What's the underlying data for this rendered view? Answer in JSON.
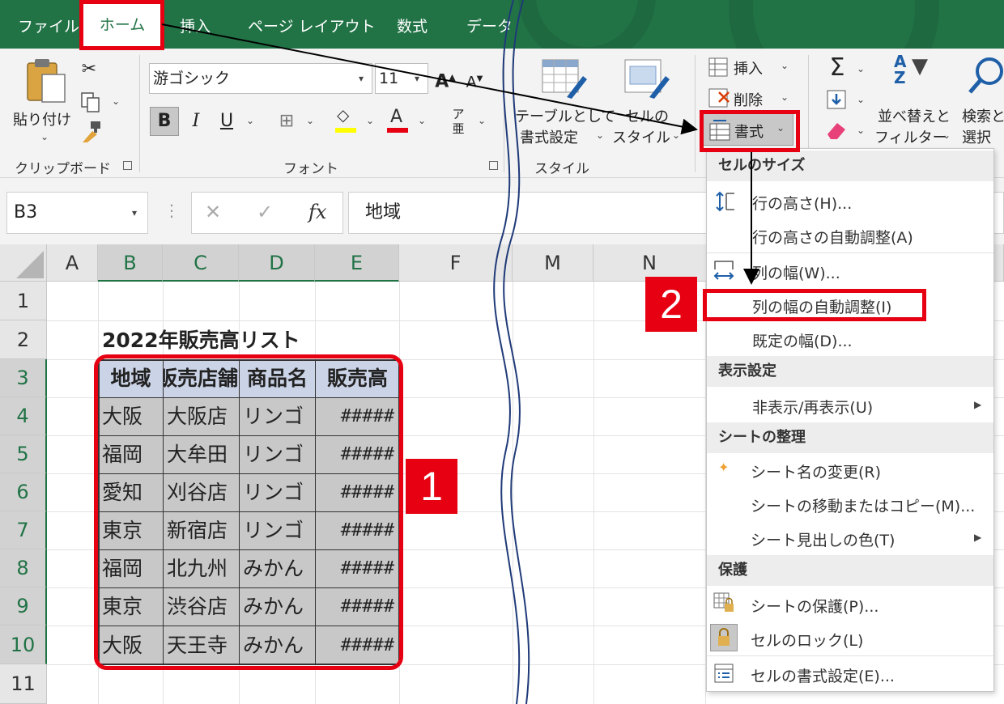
{
  "tabs": [
    "ファイル",
    "ホーム",
    "挿入",
    "ページ レイアウト",
    "数式",
    "データ"
  ],
  "active_tab": "ホーム",
  "ribbon": {
    "clipboard": {
      "paste_label": "貼り付け",
      "group_label": "クリップボード"
    },
    "font": {
      "font_name": "游ゴシック",
      "font_size": "11",
      "bold": "B",
      "italic": "I",
      "underline": "U",
      "group_label": "フォント"
    },
    "styles": {
      "table_format_line1": "テーブルとして",
      "table_format_line2": "書式設定",
      "cell_styles_line1": "セルの",
      "cell_styles_line2": "スタイル",
      "group_label": "スタイル"
    },
    "cells": {
      "insert_label": "挿入",
      "delete_label": "削除",
      "format_label": "書式"
    },
    "editing": {
      "sort_line1": "並べ替えと",
      "sort_line2": "フィルター",
      "find_line1": "検索と",
      "find_line2": "選択"
    }
  },
  "formula_bar": {
    "name_box": "B3",
    "fx_label": "fx",
    "value": "地域"
  },
  "grid": {
    "columns": [
      "A",
      "B",
      "C",
      "D",
      "E",
      "F",
      "M",
      "N"
    ],
    "rows": [
      "1",
      "2",
      "3",
      "4",
      "5",
      "6",
      "7",
      "8",
      "9",
      "10",
      "11"
    ],
    "title": "2022年販売高リスト",
    "table_headers": [
      "地域",
      "販売店舗",
      "商品名",
      "販売高"
    ],
    "table_rows": [
      [
        "大阪",
        "大阪店",
        "リンゴ",
        "#####"
      ],
      [
        "福岡",
        "大牟田",
        "リンゴ",
        "#####"
      ],
      [
        "愛知",
        "刈谷店",
        "リンゴ",
        "#####"
      ],
      [
        "東京",
        "新宿店",
        "リンゴ",
        "#####"
      ],
      [
        "福岡",
        "北九州",
        "みかん",
        "#####"
      ],
      [
        "東京",
        "渋谷店",
        "みかん",
        "#####"
      ],
      [
        "大阪",
        "天王寺",
        "みかん",
        "#####"
      ]
    ]
  },
  "format_menu": {
    "section_cell_size": "セルのサイズ",
    "row_height": "行の高さ(H)...",
    "row_autofit": "行の高さの自動調整(A)",
    "col_width": "列の幅(W)...",
    "col_autofit": "列の幅の自動調整(I)",
    "default_width": "既定の幅(D)...",
    "section_visibility": "表示設定",
    "hide_unhide": "非表示/再表示(U)",
    "section_organize": "シートの整理",
    "rename_sheet": "シート名の変更(R)",
    "move_copy": "シートの移動またはコピー(M)...",
    "tab_color": "シート見出しの色(T)",
    "section_protection": "保護",
    "protect_sheet": "シートの保護(P)...",
    "lock_cell": "セルのロック(L)",
    "format_cells": "セルの書式設定(E)..."
  },
  "annotations": {
    "step1": "1",
    "step2": "2"
  },
  "colors": {
    "excel_green": "#217346",
    "highlight_red": "#e60012",
    "table_header_blue": "#cbd3e6",
    "selection_gray": "#c8c8c8"
  }
}
